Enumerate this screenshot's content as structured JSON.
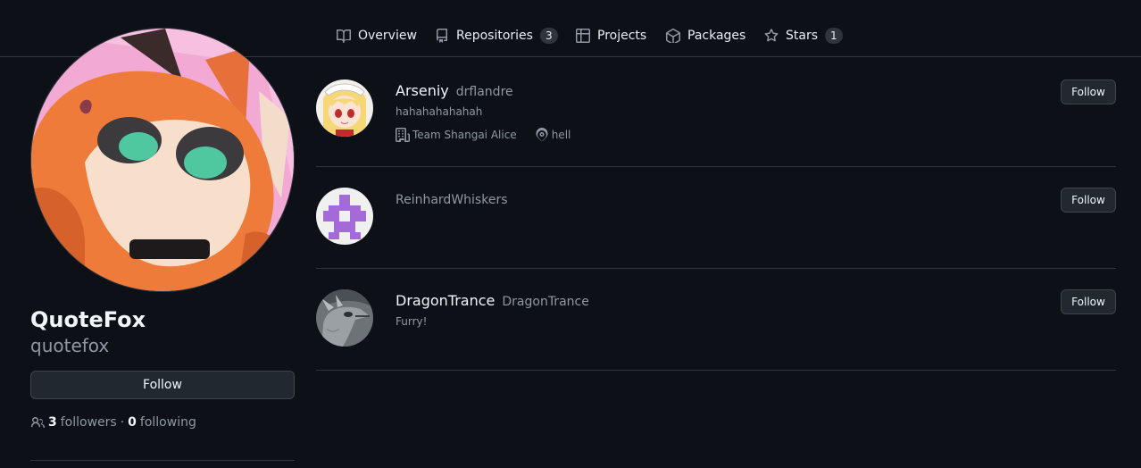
{
  "tabs": [
    {
      "label": "Overview",
      "icon": "book-icon"
    },
    {
      "label": "Repositories",
      "count": "3",
      "icon": "repo-icon"
    },
    {
      "label": "Projects",
      "icon": "table-icon"
    },
    {
      "label": "Packages",
      "icon": "package-icon"
    },
    {
      "label": "Stars",
      "count": "1",
      "icon": "star-icon"
    }
  ],
  "profile": {
    "name": "QuoteFox",
    "login": "quotefox",
    "follow_label": "Follow",
    "followers_count": "3",
    "followers_label": "followers",
    "separator": "·",
    "following_count": "0",
    "following_label": "following"
  },
  "users": [
    {
      "name": "Arseniy",
      "login": "drflandre",
      "bio": "hahahahahahah",
      "company": "Team Shangai Alice",
      "location": "hell",
      "follow_label": "Follow"
    },
    {
      "name": "",
      "login": "ReinhardWhiskers",
      "follow_label": "Follow"
    },
    {
      "name": "DragonTrance",
      "login": "DragonTrance",
      "bio": "Furry!",
      "follow_label": "Follow"
    }
  ],
  "colors": {
    "background": "#0d1117",
    "border": "#30363d",
    "muted": "#9198a1",
    "button": "#212830"
  }
}
